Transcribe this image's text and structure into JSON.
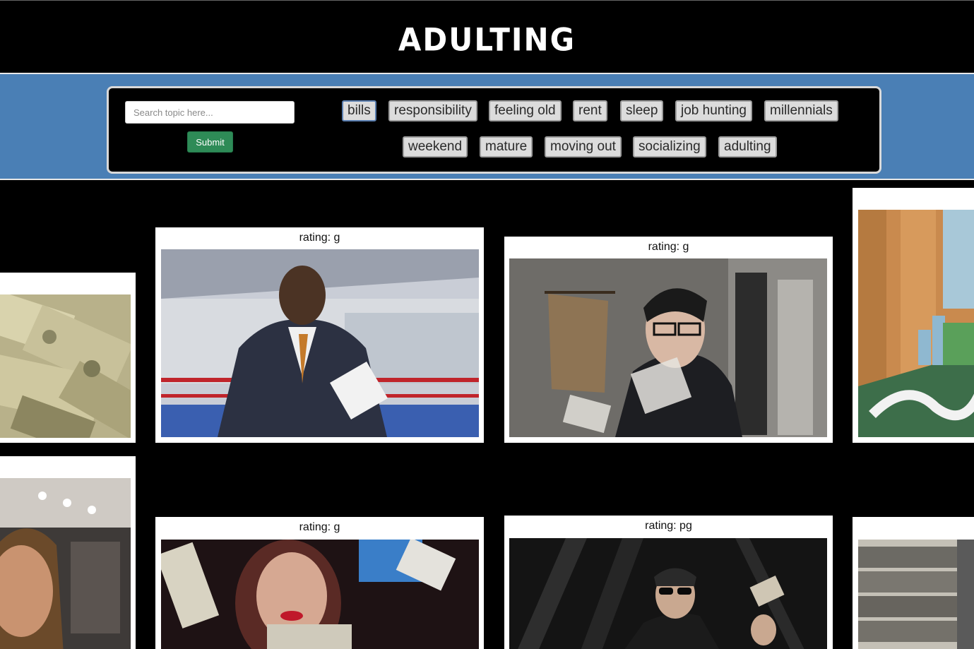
{
  "header": {
    "title": "ADULTING"
  },
  "search": {
    "placeholder": "Search topic here...",
    "value": "",
    "submit_label": "Submit"
  },
  "topics": [
    "bills",
    "responsibility",
    "feeling old",
    "rent",
    "sleep",
    "job hunting",
    "millennials",
    "weekend",
    "mature",
    "moving out",
    "socializing",
    "adulting"
  ],
  "active_topic": "bills",
  "gifs": [
    {
      "rating": "rating: g"
    },
    {
      "rating": "rating: g"
    },
    {
      "rating": "rating: g"
    },
    {
      "rating": "rating: pg"
    }
  ],
  "colors": {
    "header_bg": "#000000",
    "nav_band": "#4a7fb5",
    "submit_green": "#2e8b57",
    "topic_button_bg": "#dcdcdc"
  }
}
